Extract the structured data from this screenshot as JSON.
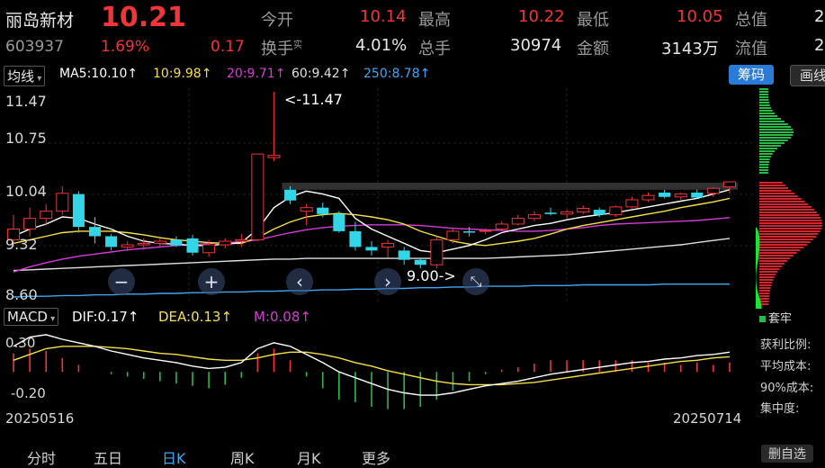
{
  "header": {
    "stock_name": "丽岛新材",
    "price": "10.21",
    "code": "603937",
    "change_pct": "1.69%",
    "change_amt": "0.17",
    "open_label": "今开",
    "open_value": "10.14",
    "high_label": "最高",
    "high_value": "10.22",
    "low_label": "最低",
    "low_value": "10.05",
    "total_value_label": "总值",
    "total_value_partial": "2",
    "turnover_label": "换手",
    "turnover_sup": "实",
    "turnover_value": "4.01%",
    "volume_label": "总手",
    "volume_value": "30974",
    "amount_label": "金额",
    "amount_value": "3143万",
    "float_label": "流值",
    "float_partial": "2"
  },
  "toolbar": {
    "indicator_select": "均线",
    "ma5": "MA5:10.10↑",
    "ma10": "10:9.98↑",
    "ma20": "20:9.71↑",
    "ma60": "60:9.42↑",
    "ma250": "250:8.78↑",
    "chips_button": "筹码",
    "draw_button": "画线"
  },
  "colors": {
    "up": "#f2343b",
    "down": "#33d6e6",
    "ma5": "#ffffff",
    "ma10": "#f5e04a",
    "ma20": "#d63cd6",
    "ma60": "#e0e0e0",
    "ma250": "#3fa8f5",
    "chips_button_bg": "#2a7bd8"
  },
  "kchart": {
    "y_labels": [
      "11.47",
      "10.75",
      "10.04",
      "9.32",
      "8.60"
    ],
    "max_annotation": "<-11.47",
    "min_annotation": "9.00->",
    "candles": [
      {
        "o": 9.4,
        "h": 9.75,
        "l": 9.3,
        "c": 9.55
      },
      {
        "o": 9.55,
        "h": 9.85,
        "l": 9.45,
        "c": 9.7
      },
      {
        "o": 9.7,
        "h": 9.9,
        "l": 9.6,
        "c": 9.8
      },
      {
        "o": 9.8,
        "h": 10.15,
        "l": 9.75,
        "c": 10.05
      },
      {
        "o": 10.04,
        "h": 10.08,
        "l": 9.5,
        "c": 9.58
      },
      {
        "o": 9.58,
        "h": 9.72,
        "l": 9.35,
        "c": 9.45
      },
      {
        "o": 9.45,
        "h": 9.48,
        "l": 9.25,
        "c": 9.3
      },
      {
        "o": 9.3,
        "h": 9.38,
        "l": 9.24,
        "c": 9.33
      },
      {
        "o": 9.33,
        "h": 9.42,
        "l": 9.26,
        "c": 9.35
      },
      {
        "o": 9.35,
        "h": 9.42,
        "l": 9.3,
        "c": 9.38
      },
      {
        "o": 9.4,
        "h": 9.45,
        "l": 9.3,
        "c": 9.32
      },
      {
        "o": 9.42,
        "h": 9.47,
        "l": 9.18,
        "c": 9.22
      },
      {
        "o": 9.22,
        "h": 9.4,
        "l": 9.16,
        "c": 9.33
      },
      {
        "o": 9.33,
        "h": 9.42,
        "l": 9.28,
        "c": 9.38
      },
      {
        "o": 9.38,
        "h": 9.48,
        "l": 9.3,
        "c": 9.4
      },
      {
        "o": 9.4,
        "h": 10.6,
        "l": 9.38,
        "c": 10.6
      },
      {
        "o": 10.55,
        "h": 11.47,
        "l": 10.5,
        "c": 10.58
      },
      {
        "o": 10.1,
        "h": 10.15,
        "l": 9.9,
        "c": 9.95
      },
      {
        "o": 9.8,
        "h": 9.9,
        "l": 9.6,
        "c": 9.85
      },
      {
        "o": 9.85,
        "h": 9.92,
        "l": 9.72,
        "c": 9.76
      },
      {
        "o": 9.76,
        "h": 9.8,
        "l": 9.5,
        "c": 9.52
      },
      {
        "o": 9.52,
        "h": 9.65,
        "l": 9.25,
        "c": 9.3
      },
      {
        "o": 9.3,
        "h": 9.38,
        "l": 9.18,
        "c": 9.25
      },
      {
        "o": 9.3,
        "h": 9.4,
        "l": 9.15,
        "c": 9.35
      },
      {
        "o": 9.25,
        "h": 9.3,
        "l": 9.05,
        "c": 9.12
      },
      {
        "o": 9.12,
        "h": 9.15,
        "l": 9.0,
        "c": 9.05
      },
      {
        "o": 9.05,
        "h": 9.45,
        "l": 9.0,
        "c": 9.4
      },
      {
        "o": 9.4,
        "h": 9.55,
        "l": 9.35,
        "c": 9.52
      },
      {
        "o": 9.52,
        "h": 9.58,
        "l": 9.45,
        "c": 9.5
      },
      {
        "o": 9.52,
        "h": 9.56,
        "l": 9.48,
        "c": 9.53
      },
      {
        "o": 9.55,
        "h": 9.66,
        "l": 9.52,
        "c": 9.62
      },
      {
        "o": 9.62,
        "h": 9.75,
        "l": 9.6,
        "c": 9.7
      },
      {
        "o": 9.7,
        "h": 9.8,
        "l": 9.66,
        "c": 9.75
      },
      {
        "o": 9.78,
        "h": 9.85,
        "l": 9.74,
        "c": 9.76
      },
      {
        "o": 9.76,
        "h": 9.82,
        "l": 9.7,
        "c": 9.79
      },
      {
        "o": 9.79,
        "h": 9.88,
        "l": 9.76,
        "c": 9.84
      },
      {
        "o": 9.82,
        "h": 9.85,
        "l": 9.72,
        "c": 9.75
      },
      {
        "o": 9.75,
        "h": 9.88,
        "l": 9.72,
        "c": 9.86
      },
      {
        "o": 9.86,
        "h": 10.0,
        "l": 9.84,
        "c": 9.96
      },
      {
        "o": 9.96,
        "h": 10.06,
        "l": 9.93,
        "c": 10.02
      },
      {
        "o": 10.06,
        "h": 10.1,
        "l": 9.98,
        "c": 10.0
      },
      {
        "o": 10.0,
        "h": 10.06,
        "l": 9.96,
        "c": 10.04
      },
      {
        "o": 10.06,
        "h": 10.1,
        "l": 9.98,
        "c": 9.99
      },
      {
        "o": 10.05,
        "h": 10.14,
        "l": 10.0,
        "c": 10.12
      },
      {
        "o": 10.14,
        "h": 10.22,
        "l": 10.05,
        "c": 10.21
      }
    ],
    "ma5": [
      9.45,
      9.55,
      9.62,
      9.72,
      9.7,
      9.62,
      9.55,
      9.45,
      9.38,
      9.35,
      9.34,
      9.32,
      9.32,
      9.34,
      9.36,
      9.55,
      9.85,
      10.0,
      10.08,
      10.04,
      9.98,
      9.7,
      9.55,
      9.45,
      9.35,
      9.25,
      9.22,
      9.27,
      9.32,
      9.4,
      9.5,
      9.55,
      9.6,
      9.63,
      9.68,
      9.72,
      9.75,
      9.78,
      9.82,
      9.86,
      9.9,
      9.94,
      9.98,
      10.04,
      10.1
    ],
    "ma10": [
      9.35,
      9.4,
      9.45,
      9.5,
      9.52,
      9.52,
      9.52,
      9.5,
      9.47,
      9.43,
      9.4,
      9.38,
      9.36,
      9.35,
      9.35,
      9.43,
      9.55,
      9.65,
      9.72,
      9.75,
      9.77,
      9.75,
      9.72,
      9.68,
      9.62,
      9.52,
      9.45,
      9.38,
      9.34,
      9.32,
      9.35,
      9.38,
      9.42,
      9.48,
      9.55,
      9.6,
      9.64,
      9.68,
      9.72,
      9.76,
      9.8,
      9.85,
      9.89,
      9.93,
      9.98
    ],
    "ma20": [
      8.95,
      9.02,
      9.08,
      9.13,
      9.17,
      9.2,
      9.23,
      9.26,
      9.28,
      9.3,
      9.32,
      9.33,
      9.35,
      9.36,
      9.37,
      9.4,
      9.45,
      9.5,
      9.54,
      9.57,
      9.59,
      9.6,
      9.61,
      9.61,
      9.61,
      9.6,
      9.58,
      9.56,
      9.55,
      9.54,
      9.53,
      9.52,
      9.52,
      9.53,
      9.55,
      9.57,
      9.6,
      9.62,
      9.63,
      9.64,
      9.65,
      9.66,
      9.67,
      9.69,
      9.71
    ],
    "ma60": [
      8.97,
      8.98,
      8.99,
      9.0,
      9.01,
      9.02,
      9.03,
      9.04,
      9.05,
      9.06,
      9.07,
      9.08,
      9.09,
      9.1,
      9.11,
      9.12,
      9.13,
      9.13,
      9.14,
      9.14,
      9.14,
      9.14,
      9.14,
      9.14,
      9.14,
      9.14,
      9.14,
      9.14,
      9.14,
      9.14,
      9.15,
      9.16,
      9.17,
      9.18,
      9.19,
      9.21,
      9.23,
      9.25,
      9.27,
      9.29,
      9.31,
      9.33,
      9.36,
      9.39,
      9.42
    ],
    "ma250": [
      8.6,
      8.61,
      8.61,
      8.62,
      8.62,
      8.63,
      8.63,
      8.64,
      8.64,
      8.65,
      8.65,
      8.66,
      8.66,
      8.67,
      8.67,
      8.68,
      8.68,
      8.69,
      8.69,
      8.7,
      8.7,
      8.71,
      8.71,
      8.72,
      8.72,
      8.73,
      8.73,
      8.74,
      8.74,
      8.75,
      8.75,
      8.75,
      8.76,
      8.76,
      8.76,
      8.77,
      8.77,
      8.77,
      8.77,
      8.77,
      8.78,
      8.78,
      8.78,
      8.78,
      8.78
    ]
  },
  "chip_chart": {
    "side_label": "套牢"
  },
  "macd_bar": {
    "select": "MACD",
    "dif": "DIF:0.17↑",
    "dea": "DEA:0.13↑",
    "m": "M:0.08↑"
  },
  "macd": {
    "y_labels": [
      "0.30",
      "-0.20"
    ],
    "dif": [
      0.22,
      0.3,
      0.32,
      0.28,
      0.25,
      0.22,
      0.18,
      0.15,
      0.12,
      0.1,
      0.08,
      0.05,
      0.03,
      0.04,
      0.08,
      0.2,
      0.25,
      0.22,
      0.15,
      0.08,
      0.0,
      -0.05,
      -0.1,
      -0.15,
      -0.18,
      -0.2,
      -0.2,
      -0.18,
      -0.15,
      -0.12,
      -0.1,
      -0.08,
      -0.05,
      -0.02,
      0.0,
      0.02,
      0.04,
      0.06,
      0.08,
      0.09,
      0.11,
      0.12,
      0.14,
      0.15,
      0.17
    ],
    "dea": [
      0.1,
      0.15,
      0.2,
      0.22,
      0.22,
      0.22,
      0.21,
      0.2,
      0.18,
      0.16,
      0.15,
      0.13,
      0.11,
      0.1,
      0.1,
      0.12,
      0.15,
      0.17,
      0.17,
      0.15,
      0.12,
      0.08,
      0.05,
      0.01,
      -0.02,
      -0.05,
      -0.08,
      -0.1,
      -0.11,
      -0.11,
      -0.11,
      -0.1,
      -0.09,
      -0.07,
      -0.05,
      -0.03,
      -0.01,
      0.01,
      0.03,
      0.05,
      0.07,
      0.09,
      0.1,
      0.12,
      0.13
    ],
    "m": [
      0.16,
      0.2,
      0.18,
      0.12,
      0.06,
      0.0,
      -0.02,
      -0.04,
      -0.06,
      -0.08,
      -0.1,
      -0.12,
      -0.14,
      -0.11,
      -0.05,
      0.16,
      0.2,
      0.1,
      -0.04,
      -0.14,
      -0.24,
      -0.26,
      -0.3,
      -0.32,
      -0.32,
      -0.3,
      -0.24,
      -0.16,
      -0.08,
      -0.02,
      0.02,
      0.04,
      0.07,
      0.1,
      0.1,
      0.1,
      0.1,
      0.1,
      0.1,
      0.08,
      0.08,
      0.06,
      0.08,
      0.06,
      0.08
    ]
  },
  "dates": {
    "start": "20250516",
    "end": "20250714"
  },
  "chip_stats": {
    "profit_ratio": "获利比例:",
    "avg_cost": "平均成本:",
    "cost_90": "90%成本:",
    "concentration": "集中度:"
  },
  "controls": {
    "zoom_out": "−",
    "zoom_in": "+",
    "prev": "‹",
    "next": "›",
    "expand": "⤡"
  },
  "bottom_tabs": [
    "分时",
    "五日",
    "日K",
    "周K",
    "月K",
    "更多"
  ],
  "bottom_right": "删自选"
}
